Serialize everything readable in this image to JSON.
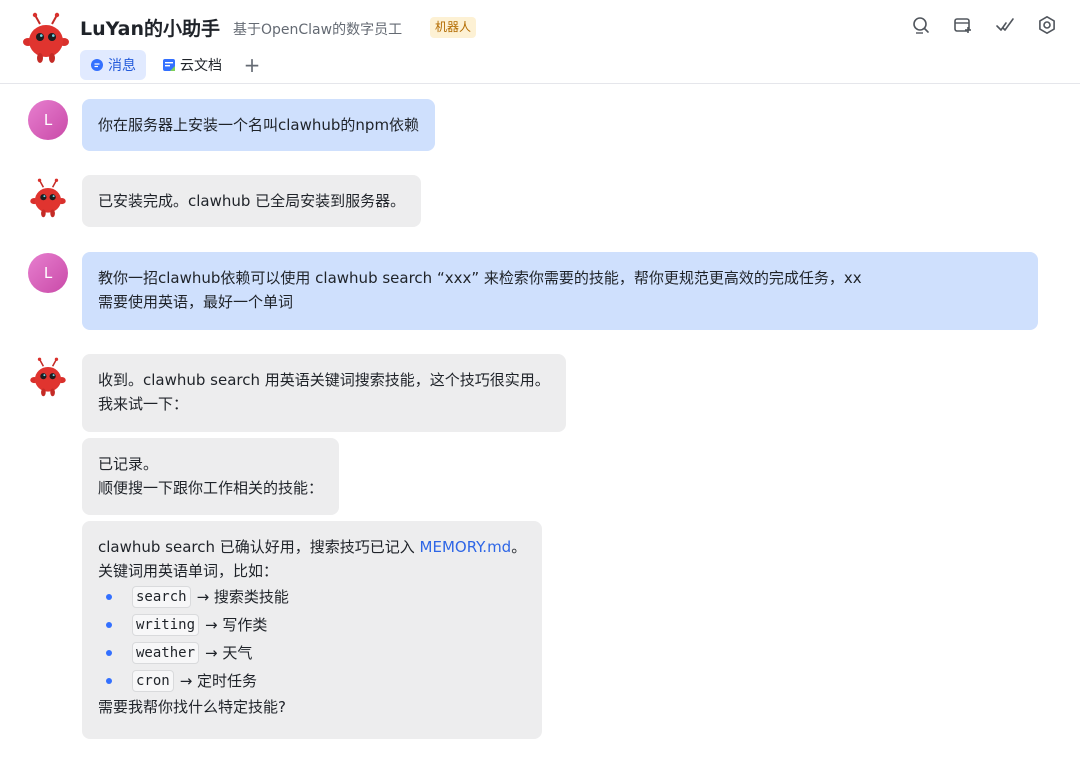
{
  "header": {
    "title": "LuYan的小助手",
    "subtitle": "基于OpenClaw的数字员工",
    "badge": "机器人",
    "tabs": [
      {
        "label": "消息",
        "icon": "chat-bubble-icon",
        "active": true
      },
      {
        "label": "云文档",
        "icon": "doc-icon",
        "active": false
      }
    ],
    "add_tab": "+",
    "toolbar_icons": [
      "search-icon",
      "new-window-icon",
      "checkmark-icon",
      "settings-icon"
    ]
  },
  "user": {
    "initial": "L"
  },
  "messages": [
    {
      "sender": "user",
      "lines": [
        "你在服务器上安装一个名叫clawhub的npm依赖"
      ]
    },
    {
      "sender": "bot",
      "lines": [
        "已安装完成。clawhub 已全局安装到服务器。"
      ]
    },
    {
      "sender": "user",
      "lines": [
        "教你一招clawhub依赖可以使用 clawhub search “xxx” 来检索你需要的技能，帮你更规范更高效的完成任务，xx",
        "需要使用英语，最好一个单词"
      ]
    },
    {
      "sender": "bot",
      "lines": [
        "收到。clawhub search 用英语关键词搜索技能，这个技巧很实用。",
        "我来试一下："
      ]
    },
    {
      "sender": "bot",
      "lines": [
        "已记录。",
        "顺便搜一下跟你工作相关的技能："
      ]
    },
    {
      "sender": "bot",
      "intro_prefix": "clawhub search 已确认好用，搜索技巧已记入 ",
      "intro_link": "MEMORY.md",
      "intro_suffix": "。",
      "line2": "关键词用英语单词，比如：",
      "list": [
        {
          "code": "search",
          "desc": "→ 搜索类技能"
        },
        {
          "code": "writing",
          "desc": "→ 写作类"
        },
        {
          "code": "weather",
          "desc": "→ 天气"
        },
        {
          "code": "cron",
          "desc": "→ 定时任务"
        }
      ],
      "closing": "需要我帮你找什么特定技能?"
    }
  ],
  "colors": {
    "accent": "#3370ff",
    "user_bubble": "#cfe0fd",
    "bot_bubble": "#ededee",
    "bot_avatar": "#d9302c"
  }
}
